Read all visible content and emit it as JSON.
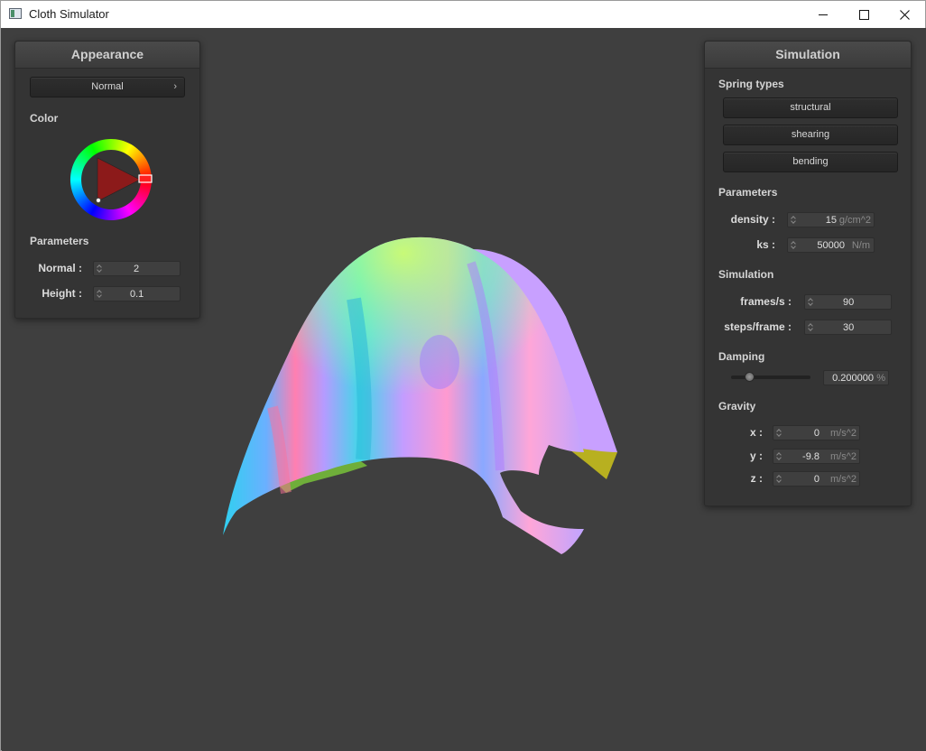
{
  "window": {
    "title": "Cloth Simulator"
  },
  "appearance": {
    "title": "Appearance",
    "shader": "Normal",
    "color_label": "Color",
    "params_label": "Parameters",
    "normal_label": "Normal :",
    "normal_value": "2",
    "height_label": "Height :",
    "height_value": "0.1"
  },
  "simulation": {
    "title": "Simulation",
    "spring_types_label": "Spring types",
    "spring_types": [
      "structural",
      "shearing",
      "bending"
    ],
    "params_label": "Parameters",
    "density": {
      "label": "density :",
      "value": "15",
      "unit": "g/cm^2"
    },
    "ks": {
      "label": "ks :",
      "value": "50000",
      "unit": "N/m"
    },
    "sim_label": "Simulation",
    "fps": {
      "label": "frames/s :",
      "value": "90"
    },
    "steps": {
      "label": "steps/frame :",
      "value": "30"
    },
    "damping_label": "Damping",
    "damping": {
      "value": "0.200000",
      "unit": "%",
      "slider_fraction": 0.2
    },
    "gravity_label": "Gravity",
    "gravity": [
      {
        "label": "x :",
        "value": "0",
        "unit": "m/s^2"
      },
      {
        "label": "y :",
        "value": "-9.8",
        "unit": "m/s^2"
      },
      {
        "label": "z :",
        "value": "0",
        "unit": "m/s^2"
      }
    ]
  },
  "colors": {
    "background": "#3f3f3f",
    "panel": "#343434",
    "selected_color": "#ff0000"
  }
}
